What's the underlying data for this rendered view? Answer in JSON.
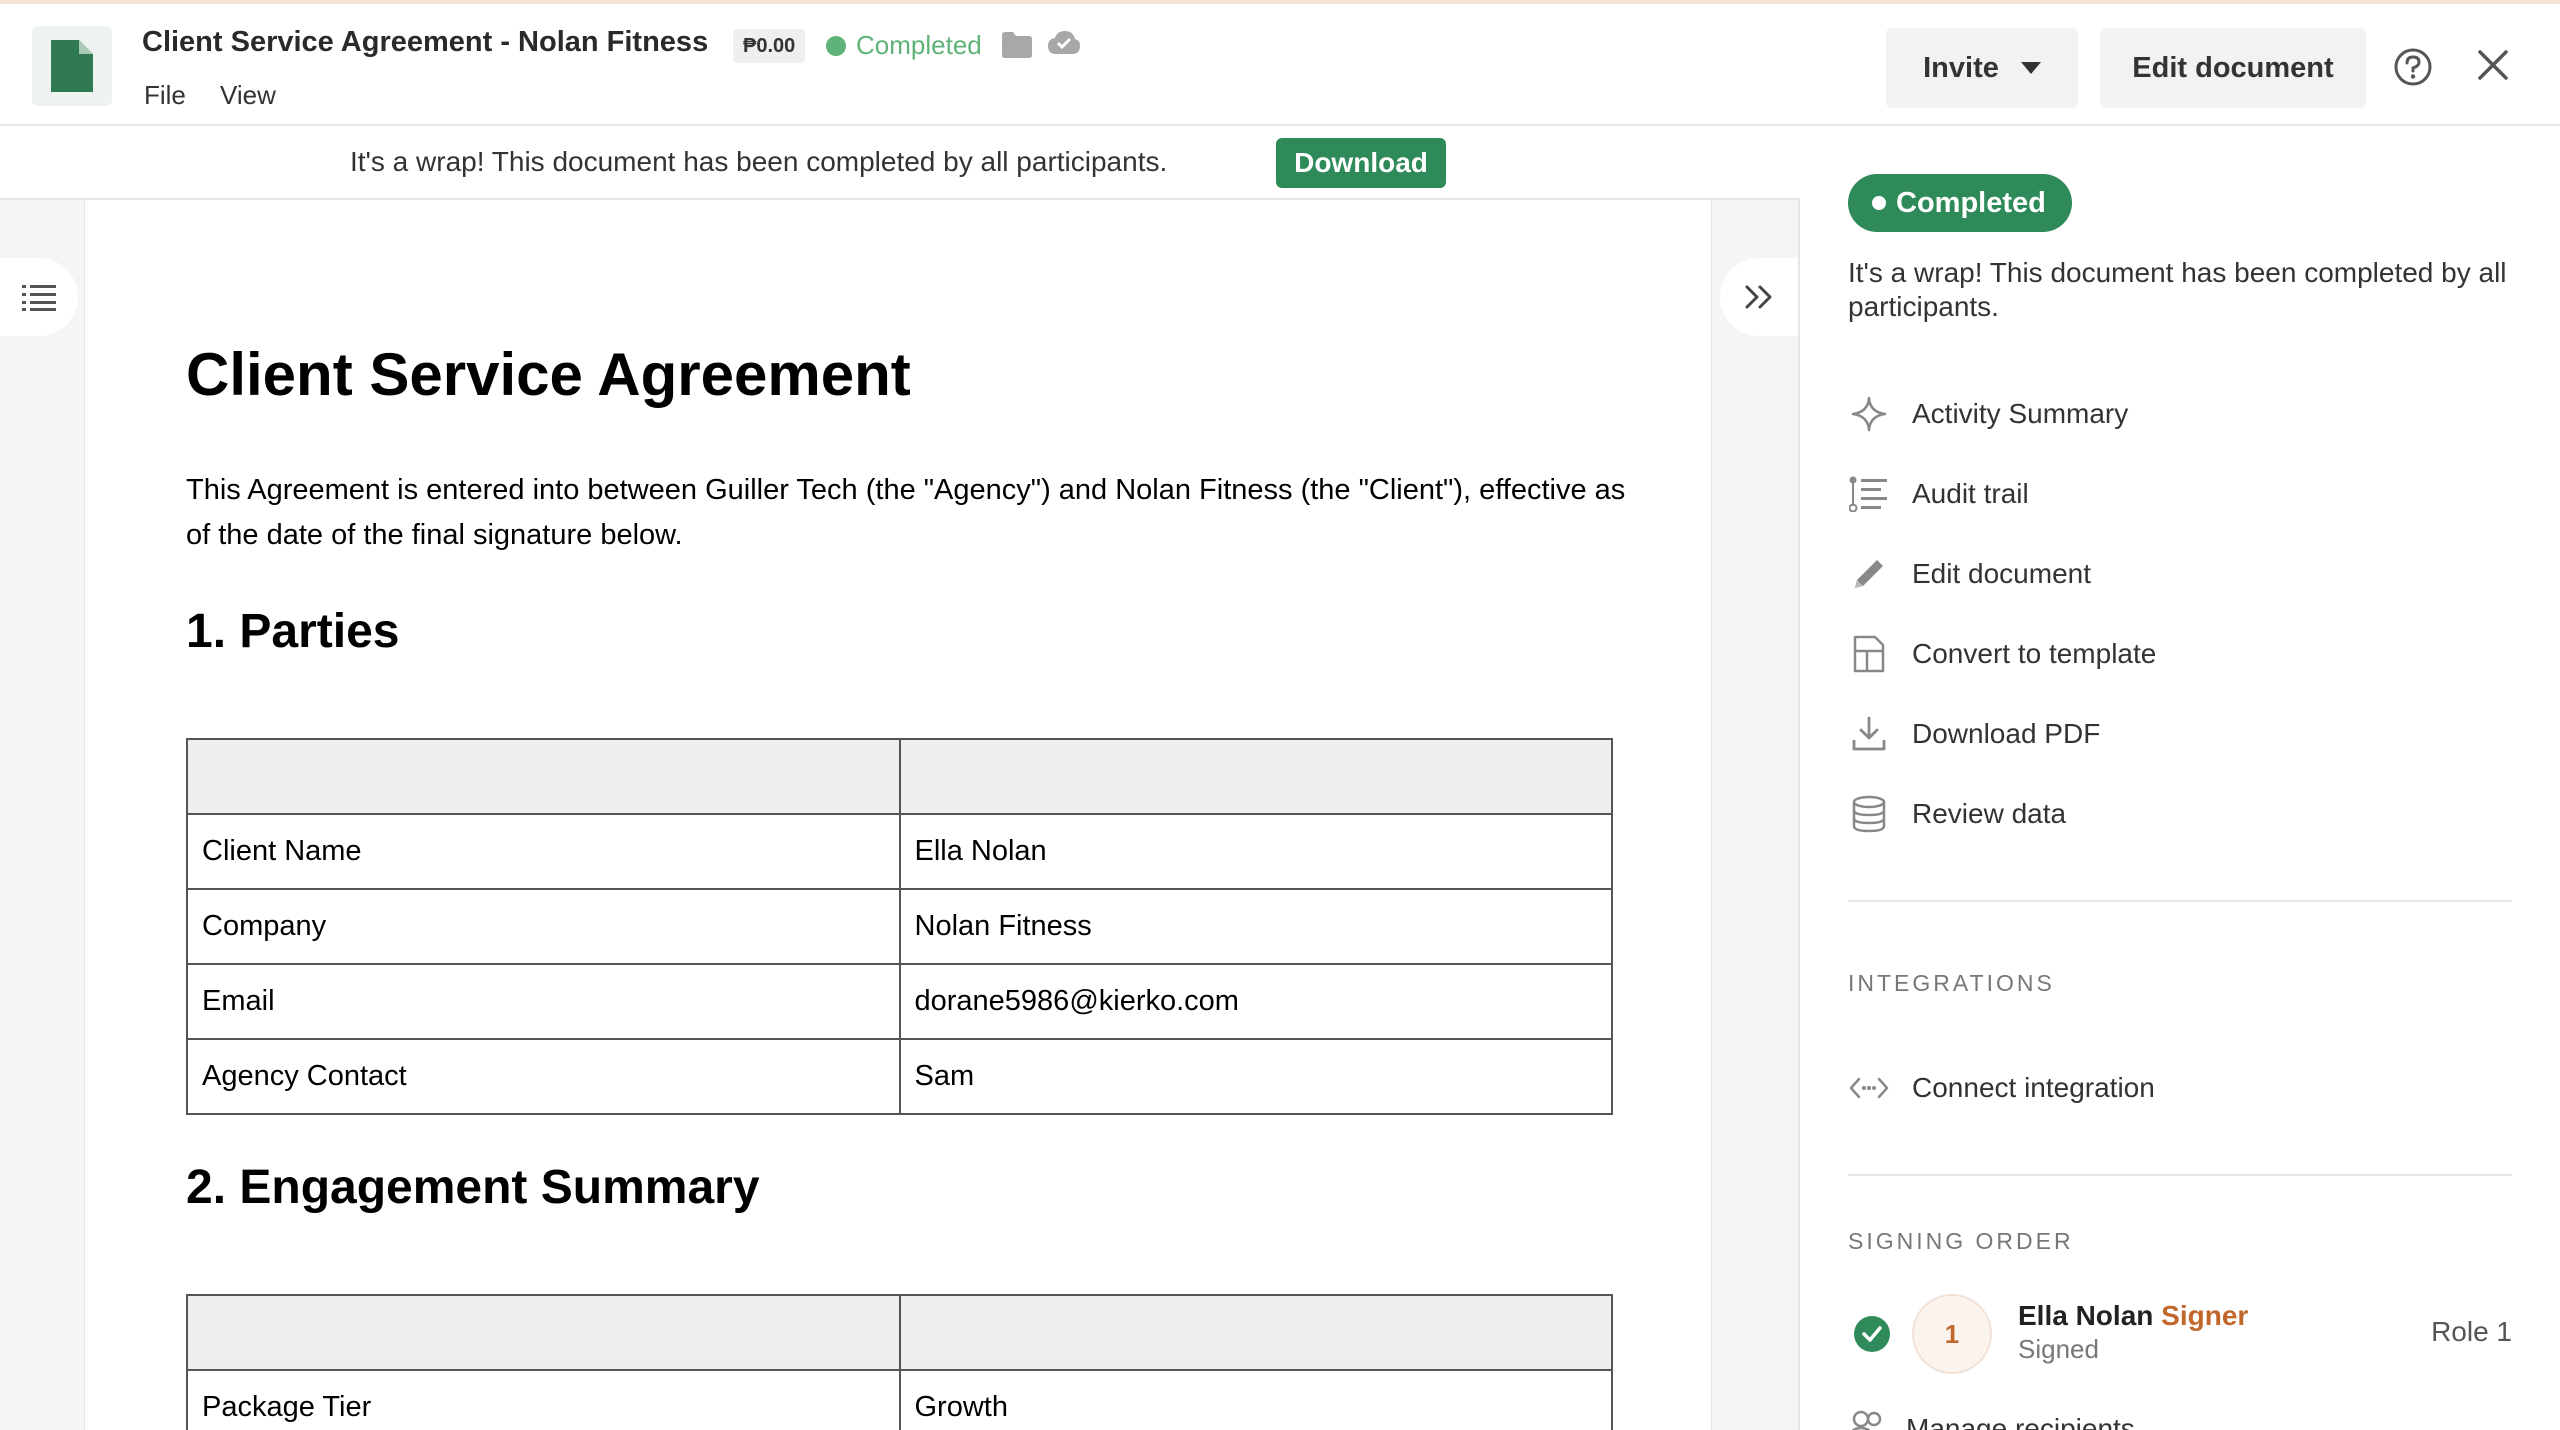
{
  "header": {
    "title": "Client Service Agreement - Nolan Fitness",
    "price": "₱0.00",
    "status": "Completed",
    "menu": [
      "File",
      "View"
    ],
    "invite_label": "Invite",
    "edit_label": "Edit document",
    "icons": [
      "document-icon",
      "folder-icon",
      "cloud-check-icon",
      "help-icon",
      "close-icon"
    ]
  },
  "banner": {
    "text": "It's a wrap! This document has been completed by all participants.",
    "button": "Download"
  },
  "document": {
    "title": "Client Service Agreement",
    "intro": "This Agreement is entered into between Guiller Tech (the \"Agency\") and Nolan Fitness (the \"Client\"), effective as of the date of the final signature below.",
    "sections": [
      {
        "heading": "1. Parties",
        "header_row": [
          "",
          ""
        ],
        "rows": [
          [
            "Client Name",
            "Ella Nolan"
          ],
          [
            "Company",
            "Nolan Fitness"
          ],
          [
            "Email",
            "dorane5986@kierko.com"
          ],
          [
            "Agency Contact",
            "Sam"
          ]
        ]
      },
      {
        "heading": "2. Engagement Summary",
        "header_row": [
          "",
          ""
        ],
        "rows": [
          [
            "Package Tier",
            "Growth"
          ]
        ]
      }
    ]
  },
  "panel": {
    "status": "Completed",
    "message": "It's a wrap! This document has been completed by all participants.",
    "actions": [
      {
        "label": "Activity Summary",
        "icon": "sparkle-icon"
      },
      {
        "label": "Audit trail",
        "icon": "audit-list-icon"
      },
      {
        "label": "Edit document",
        "icon": "pencil-icon"
      },
      {
        "label": "Convert to template",
        "icon": "template-icon"
      },
      {
        "label": "Download PDF",
        "icon": "download-icon"
      },
      {
        "label": "Review data",
        "icon": "database-icon"
      }
    ],
    "integrations_label": "INTEGRATIONS",
    "connect_label": "Connect integration",
    "signing_order_label": "SIGNING ORDER",
    "signer": {
      "order": "1",
      "name": "Ella Nolan",
      "role": "Signer",
      "status": "Signed",
      "role_label": "Role 1"
    },
    "manage_label": "Manage recipients"
  },
  "colors": {
    "accent_green": "#2f8a5a",
    "status_green": "#5fb379",
    "signer_orange": "#c2672c"
  }
}
